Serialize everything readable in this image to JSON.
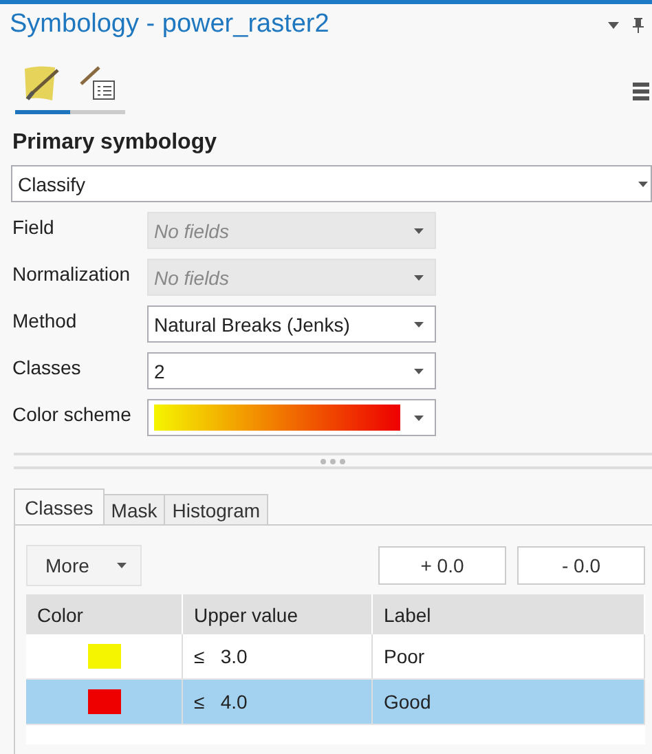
{
  "pane": {
    "title": "Symbology - power_raster2"
  },
  "view_tabs": [
    {
      "kind": "symbology",
      "selected": true
    },
    {
      "kind": "settings",
      "selected": false
    }
  ],
  "primary_symbology": {
    "heading": "Primary symbology",
    "renderer": "Classify"
  },
  "fields": [
    {
      "label": "Field",
      "value": "No fields",
      "disabled": true,
      "kind": "dropdown"
    },
    {
      "label": "Normalization",
      "value": "No fields",
      "disabled": true,
      "kind": "dropdown"
    },
    {
      "label": "Method",
      "value": "Natural Breaks (Jenks)",
      "disabled": false,
      "kind": "dropdown"
    },
    {
      "label": "Classes",
      "value": "2",
      "disabled": false,
      "kind": "dropdown"
    },
    {
      "label": "Color scheme",
      "disabled": false,
      "kind": "ramp"
    }
  ],
  "tabs": [
    {
      "label": "Classes",
      "selected": true
    },
    {
      "label": "Mask",
      "selected": false
    },
    {
      "label": "Histogram",
      "selected": false
    }
  ],
  "more_button": "More",
  "adjust_buttons": [
    "+ 0.0",
    "- 0.0"
  ],
  "table": {
    "columns": [
      "Color",
      "Upper value",
      "Label"
    ],
    "rows": [
      {
        "color": "#f5f500",
        "upper_value": "≤   3.0",
        "label": "Poor",
        "selected": false
      },
      {
        "color": "#ee0000",
        "upper_value": "≤   4.0",
        "label": "Good",
        "selected": true
      }
    ]
  }
}
